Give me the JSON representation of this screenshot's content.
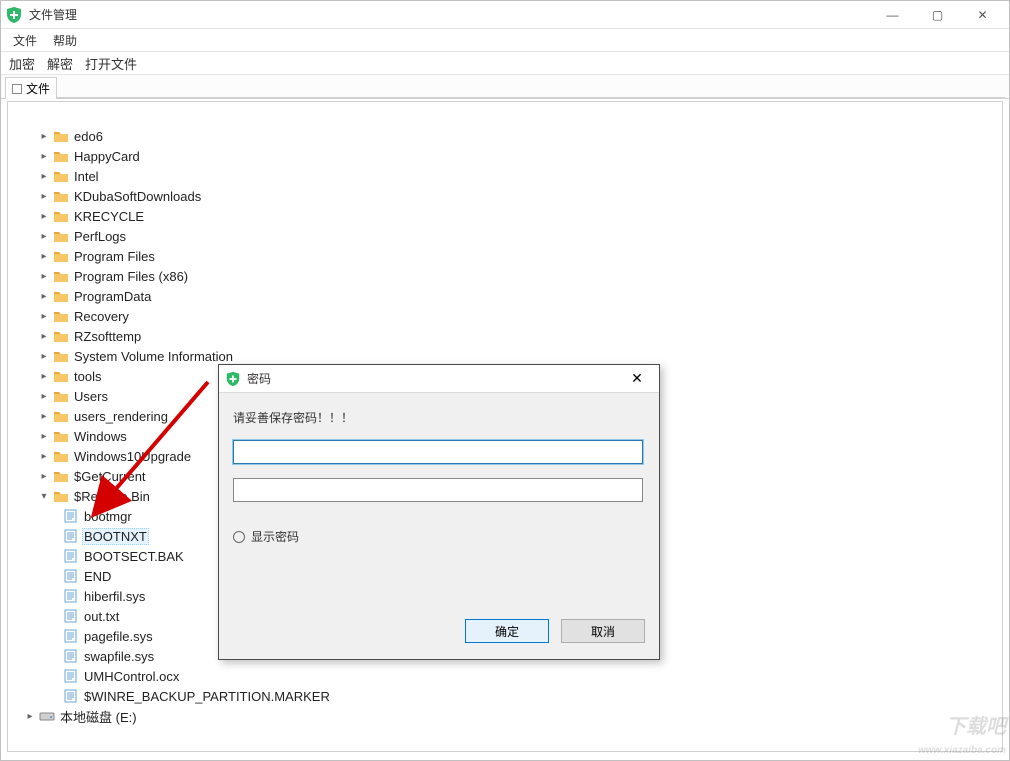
{
  "window": {
    "title": "文件管理"
  },
  "menubar": {
    "file": "文件",
    "help": "帮助"
  },
  "toolbar": {
    "encrypt": "加密",
    "decrypt": "解密",
    "open": "打开文件"
  },
  "tabs": {
    "file_tab": "文件"
  },
  "tree": {
    "folders_depth2": [
      "edo6",
      "HappyCard",
      "Intel",
      "KDubaSoftDownloads",
      "KRECYCLE",
      "PerfLogs",
      "Program Files",
      "Program Files (x86)",
      "ProgramData",
      "Recovery",
      "RZsofttemp",
      "System Volume Information",
      "tools",
      "Users",
      "users_rendering",
      "Windows",
      "Windows10Upgrade",
      "$GetCurrent",
      "$Recycle.Bin"
    ],
    "files_depth3": [
      "bootmgr",
      "BOOTNXT",
      "BOOTSECT.BAK",
      "END",
      "hiberfil.sys",
      "out.txt",
      "pagefile.sys",
      "swapfile.sys",
      "UMHControl.ocx",
      "$WINRE_BACKUP_PARTITION.MARKER"
    ],
    "selected_file": "BOOTNXT",
    "expanded_folder": "$Recycle.Bin",
    "drive": "本地磁盘 (E:)"
  },
  "dialog": {
    "title": "密码",
    "message": "请妥善保存密码！！！",
    "show_pw_label": "显示密码",
    "ok": "确定",
    "cancel": "取消",
    "pw1": "",
    "pw2": ""
  },
  "watermark": "下载吧"
}
